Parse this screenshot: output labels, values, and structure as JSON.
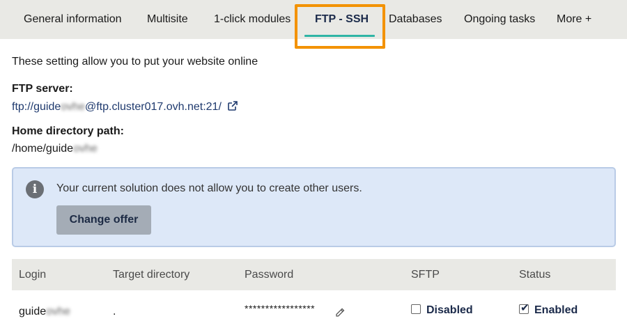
{
  "tabs": [
    {
      "label": "General information"
    },
    {
      "label": "Multisite"
    },
    {
      "label": "1-click modules"
    },
    {
      "label": "FTP - SSH"
    },
    {
      "label": "Databases"
    },
    {
      "label": "Ongoing tasks"
    },
    {
      "label": "More +"
    }
  ],
  "active_tab": "FTP - SSH",
  "intro": "These setting allow you to put your website online",
  "ftp": {
    "label": "FTP server:",
    "prefix": "ftp://guide",
    "blurred": "ovhe",
    "suffix": "@ftp.cluster017.ovh.net:21/",
    "icon": "external-link-icon"
  },
  "home": {
    "label": "Home directory path:",
    "prefix": "/home/guide",
    "blurred": "ovhe"
  },
  "info": {
    "icon": "info-icon",
    "message": "Your current solution does not allow you to create other users.",
    "button": "Change offer"
  },
  "table": {
    "headers": [
      "Login",
      "Target directory",
      "Password",
      "SFTP",
      "Status"
    ],
    "row": {
      "login_prefix": "guide",
      "login_blurred": "ovhe",
      "target": ".",
      "password": "*****************",
      "password_icon": "pencil-icon",
      "sftp": {
        "label": "Disabled",
        "checked": false
      },
      "status": {
        "label": "Enabled",
        "checked": true
      }
    }
  },
  "colors": {
    "tab_bar": "#e9e9e5",
    "tab_underline": "#2fb4a5",
    "highlight": "#f39200",
    "info_bg": "#dde8f8",
    "button_bg": "#a4acb6"
  }
}
